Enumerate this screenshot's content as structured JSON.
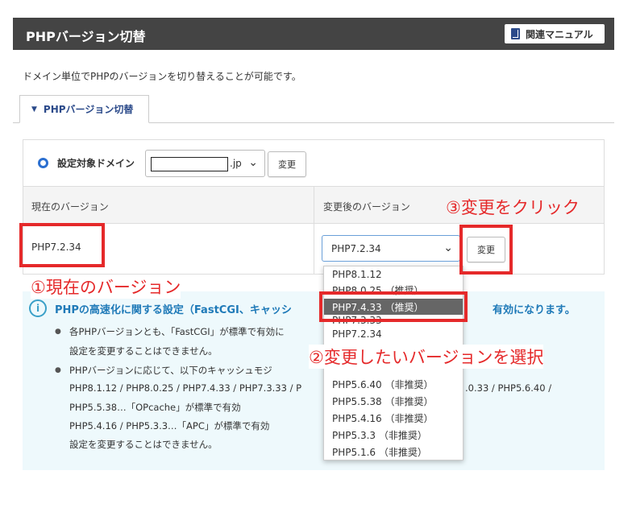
{
  "header": {
    "title": "PHPバージョン切替",
    "manual_button": "関連マニュアル"
  },
  "description": "ドメイン単位でPHPのバージョンを切り替えることが可能です。",
  "tab": {
    "label": "PHPバージョン切替"
  },
  "domain": {
    "label": "設定対象ドメイン",
    "value": "",
    "suffix": ".jp",
    "change_button": "変更"
  },
  "table": {
    "col_current": "現在のバージョン",
    "col_new": "変更後のバージョン",
    "current_version": "PHP7.2.34",
    "selected_version": "PHP7.2.34",
    "change_button": "変更"
  },
  "dropdown": {
    "options": [
      "PHP8.1.12",
      "PHP8.0.25 （推奨）",
      "PHP7.4.33 （推奨）",
      "PHP7.3.33",
      "PHP7.2.34",
      "PHP5.6.40 （非推奨）",
      "PHP5.5.38 （非推奨）",
      "PHP5.4.16 （非推奨）",
      "PHP5.3.3 （非推奨）",
      "PHP5.1.6 （非推奨）"
    ],
    "highlighted": "PHP7.4.33 （推奨）"
  },
  "info": {
    "title": "PHPの高速化に関する設定（FastCGI、キャッシ",
    "title_tail": "有効になります。",
    "line1": "各PHPバージョンとも、「FastCGI」が標準で有効に",
    "line2": "設定を変更することはできません。",
    "line3": "PHPバージョンに応じて、以下のキャッシュモジ",
    "line4a": "PHP8.1.12 / PHP8.0.25 / PHP7.4.33 / PHP7.3.33 / P",
    "line4b": ".0.33 / PHP5.6.40 /",
    "line5": "PHP5.5.38…「OPcache」が標準で有効",
    "line6": "PHP5.4.16 / PHP5.3.3…「APC」が標準で有効",
    "line7": "設定を変更することはできません。"
  },
  "annotations": {
    "step1": "①現在のバージョン",
    "step2": "②変更したいバージョンを選択",
    "step3": "③変更をクリック",
    "color": "#e5292a"
  }
}
